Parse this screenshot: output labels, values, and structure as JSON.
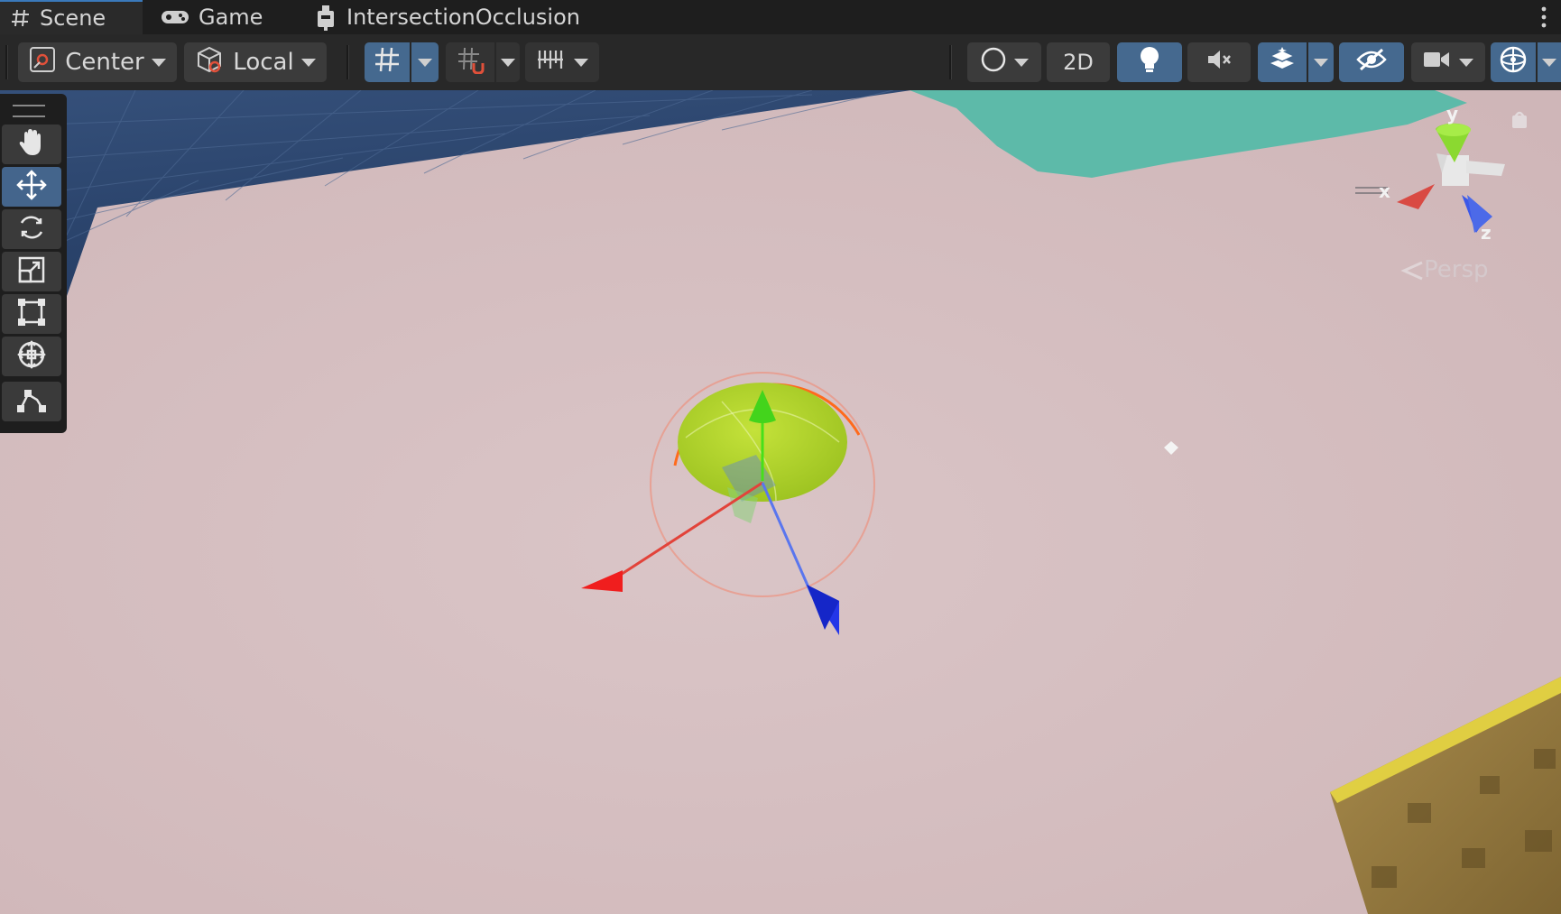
{
  "tabs": [
    {
      "label": "Scene",
      "icon": "hash-icon",
      "active": true
    },
    {
      "label": "Game",
      "icon": "gamepad-icon",
      "active": false
    },
    {
      "label": "IntersectionOcclusion",
      "icon": "package-icon",
      "active": false
    }
  ],
  "toolbar": {
    "pivot_label": "Center",
    "space_label": "Local",
    "two_d_label": "2D"
  },
  "tools": [
    "hand-tool",
    "move-tool",
    "rotate-tool",
    "scale-tool",
    "rect-tool",
    "transform-tool",
    "custom-editor-tool"
  ],
  "active_tool": "move-tool",
  "gizmo": {
    "projection_label": "Persp",
    "axis_x": "x",
    "axis_y": "y",
    "axis_z": "z"
  },
  "colors": {
    "accent_blue": "#45698f",
    "floor": "#d6bfc1",
    "grid_plane": "#2d4770",
    "teal": "#5dbaa9",
    "object_green": "#b4d72c"
  }
}
